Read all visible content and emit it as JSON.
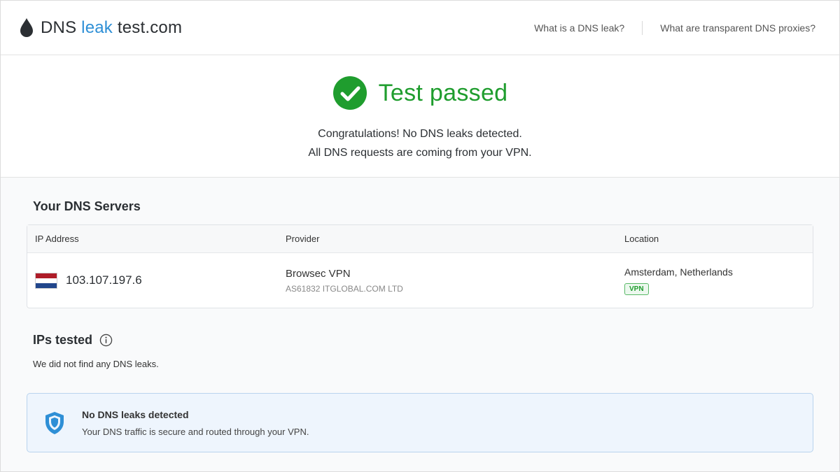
{
  "header": {
    "logo": {
      "part1": "DNS",
      "part2": "leak",
      "part3": "test.com",
      "icon": "droplet-icon"
    },
    "nav": [
      {
        "label": "What is a DNS leak?"
      },
      {
        "label": "What are transparent DNS proxies?"
      }
    ]
  },
  "hero": {
    "status_icon": "check-circle-icon",
    "status": "Test passed",
    "line1": "Congratulations! No DNS leaks detected.",
    "line2": "All DNS requests are coming from your VPN."
  },
  "servers": {
    "title": "Your DNS Servers",
    "columns": [
      "IP Address",
      "Provider",
      "Location"
    ],
    "rows": [
      {
        "flag_icon": "netherlands-flag-icon",
        "ip": "103.107.197.6",
        "provider": "Browsec VPN",
        "asn": "AS61832 ITGLOBAL.COM LTD",
        "location": "Amsterdam, Netherlands",
        "badge": "VPN"
      }
    ]
  },
  "ips_tested": {
    "title": "IPs tested",
    "info_icon": "info-icon",
    "note": "We did not find any DNS leaks."
  },
  "alert": {
    "icon": "shield-icon",
    "title": "No DNS leaks detected",
    "body": "Your DNS traffic is secure and routed through your VPN."
  },
  "colors": {
    "success": "#1f9d2e",
    "accent": "#2e8fd6",
    "alert_bg": "#eef5fd",
    "flag_red": "#ae1c28",
    "flag_white": "#ffffff",
    "flag_blue": "#21468b"
  }
}
